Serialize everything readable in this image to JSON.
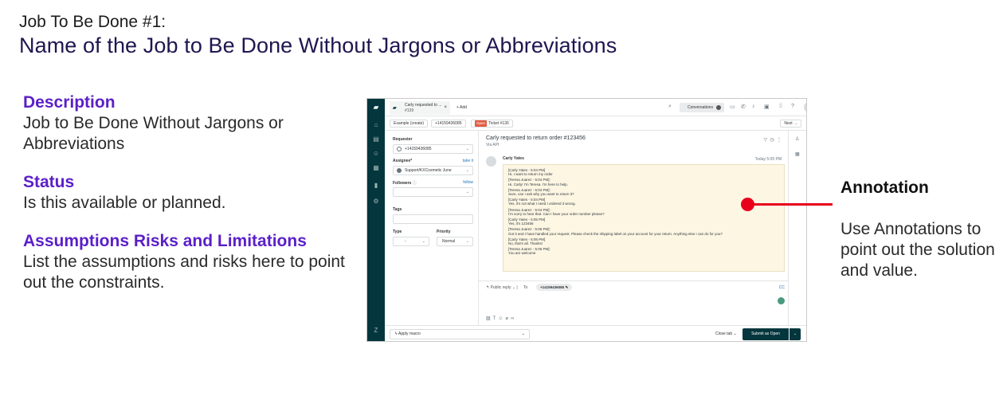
{
  "slide": {
    "label": "Job To Be Done #1:",
    "title": "Name of the Job to Be Done Without Jargons or Abbreviations"
  },
  "sections": [
    {
      "heading": "Description",
      "body": "Job to Be Done Without Jargons or Abbreviations"
    },
    {
      "heading": "Status",
      "body": "Is this available or planned."
    },
    {
      "heading": "Assumptions Risks and Limitations",
      "body": "List the assumptions and risks here to point out the constraints."
    }
  ],
  "annotation": {
    "title": "Annotation",
    "body": "Use Annotations to point out the solution and value.",
    "color": "#e8001c"
  },
  "screenshot": {
    "tab": {
      "title": "Carly requested to ...",
      "subtitle": "#139",
      "close": "×"
    },
    "add_tab": "+ Add",
    "conversations_label": "Conversations",
    "crumbs": {
      "example": "Example (create)",
      "phone": "+14159436085",
      "status_badge": "Open",
      "ticket": "Ticket #130",
      "next": "Next →"
    },
    "requester": {
      "label": "Requester",
      "value": "+14159436085"
    },
    "assignee": {
      "label": "Assignee*",
      "link": "take it",
      "value": "Support/KXCosmetic June"
    },
    "followers": {
      "label": "Followers",
      "link": "follow"
    },
    "tags": {
      "label": "Tags"
    },
    "type": {
      "label": "Type",
      "value": "-"
    },
    "priority": {
      "label": "Priority",
      "value": "Normal"
    },
    "subject": "Carly requested to return order #123456",
    "via": "Via API",
    "author": "Carly Yates",
    "time": "Today 5:05 PM",
    "messages": [
      [
        "[Carly Yates - 5:04 PM]",
        "Hi, I want to return my order"
      ],
      [
        "[Teresa Juarez - 5:04 PM]:",
        "Hi, Carly! I'm Teresa. I'm here to help."
      ],
      [
        "[Teresa Juarez - 5:04 PM]:",
        "Sure, can I ask why you want to return it?"
      ],
      [
        "[Carly Yates - 5:04 PM]",
        "Yes, it's not what I need I ordered it wrong."
      ],
      [
        "[Teresa Juarez - 5:04 PM]:",
        "I'm sorry to hear that. Can I have your order number please?"
      ],
      [
        "[Carly Yates - 5:05 PM]",
        "Yes, it's 123456"
      ],
      [
        "[Teresa Juarez - 5:05 PM]:",
        "Got it and I have handled your request. Please check the shipping label on your account for your return. Anything else I can do for you?"
      ],
      [
        "[Carly Yates - 5:05 PM]",
        "No, that's all. Thanks!"
      ],
      [
        "[Teresa Juarez - 5:05 PM]:",
        "You are welcome"
      ]
    ],
    "reply": {
      "mode": "Public reply",
      "to": "To",
      "recipient": "+14159436085",
      "cc": "CC"
    },
    "apply_macro": "Apply macro",
    "close_tab": "Close tab",
    "submit": "Submit as Open"
  }
}
